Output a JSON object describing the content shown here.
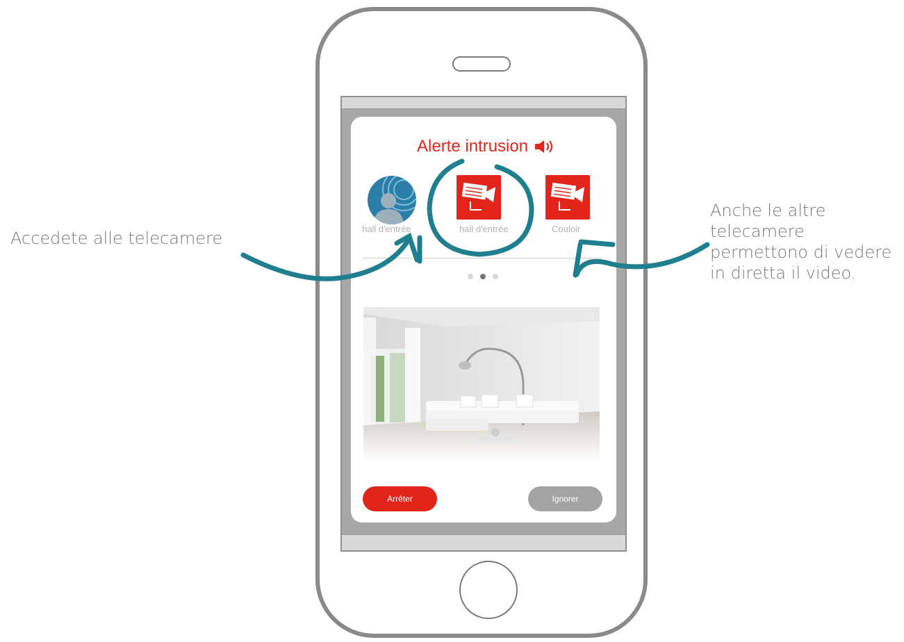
{
  "alert": {
    "title": "Alerte intrusion",
    "icon": "alarm-speaker-icon"
  },
  "cameras": [
    {
      "label": "hall d'entrée",
      "icon": "user-avatar-icon",
      "state": "partial"
    },
    {
      "label": "hall d'entrée",
      "icon": "security-camera-icon",
      "state": "selected"
    },
    {
      "label": "Couloir",
      "icon": "security-camera-icon",
      "state": "normal"
    }
  ],
  "pagination": {
    "total": 3,
    "active": 2
  },
  "live_view": {
    "description_icon": "living-room-camera-feed"
  },
  "buttons": {
    "stop_label": "Arrêter",
    "ignore_label": "Ignorer"
  },
  "annotations": {
    "left": "Accedete alle telecamere",
    "right_lines": [
      "Anche le altre",
      "telecamere",
      "permettono di vedere",
      "in diretta il video."
    ]
  },
  "colors": {
    "accent_red": "#e1251b",
    "annotation_teal": "#1f7f8f",
    "button_grey": "#a3a3a3",
    "phone_frame": "#8a8a8a"
  }
}
